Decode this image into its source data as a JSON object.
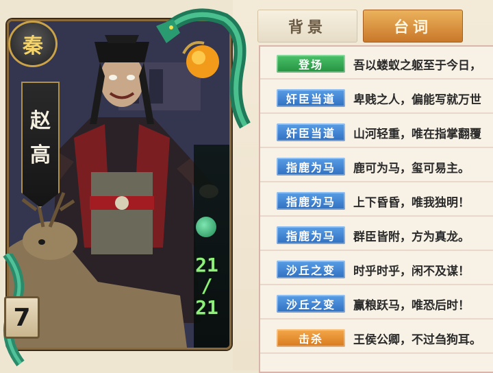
{
  "hero": {
    "faction": "秦",
    "name_chars": [
      "赵",
      "高"
    ],
    "hp_current": "21",
    "hp_separator": "/",
    "hp_max": "21",
    "cost": "7"
  },
  "tabs": [
    {
      "label": "背景",
      "active": false
    },
    {
      "label": "台词",
      "active": true
    }
  ],
  "lines": [
    {
      "tag": "登场",
      "tag_color": "green",
      "text": "吾以蝼蚁之躯至于今日，"
    },
    {
      "tag": "奸臣当道",
      "tag_color": "blue",
      "text": "卑贱之人，偏能写就万世"
    },
    {
      "tag": "奸臣当道",
      "tag_color": "blue",
      "text": "山河轻重，唯在指掌翻覆"
    },
    {
      "tag": "指鹿为马",
      "tag_color": "blue",
      "text": "鹿可为马，玺可易主。"
    },
    {
      "tag": "指鹿为马",
      "tag_color": "blue",
      "text": "上下昏昏，唯我独明！"
    },
    {
      "tag": "指鹿为马",
      "tag_color": "blue",
      "text": "群臣皆附，方为真龙。"
    },
    {
      "tag": "沙丘之变",
      "tag_color": "blue",
      "text": "时乎时乎，闲不及谋！"
    },
    {
      "tag": "沙丘之变",
      "tag_color": "blue",
      "text": "赢粮跃马，唯恐后时！"
    },
    {
      "tag": "击杀",
      "tag_color": "orange",
      "text": "王侯公卿，不过刍狗耳。"
    }
  ],
  "colors": {
    "tag_green": "#24913f",
    "tag_blue": "#2f6fc0",
    "tag_orange": "#d77a1e",
    "tab_active": "#c9782a",
    "hp_text": "#8ef07a"
  },
  "icons": [
    "dragon-ornament-icon",
    "jade-hp-icon"
  ]
}
